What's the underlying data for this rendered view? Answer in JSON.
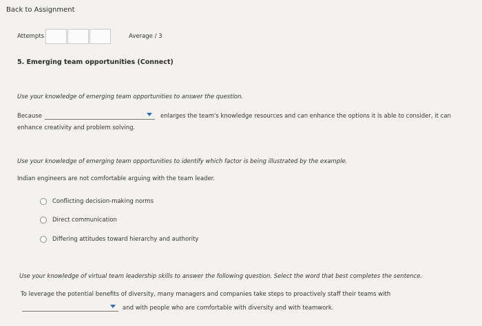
{
  "nav": {
    "back_link": "Back to Assignment"
  },
  "attempts": {
    "label": "Attempts",
    "average_label": "Average / 3"
  },
  "question": {
    "title": "5. Emerging team opportunities (Connect)",
    "part1": {
      "instruction": "Use your knowledge of emerging team opportunities to answer the question.",
      "prefix": "Because",
      "dropdown_value": "",
      "suffix": "enlarges the team's knowledge resources and can enhance the options it is able to consider, it can",
      "line2": "enhance creativity and problem solving."
    },
    "part2": {
      "instruction": "Use your knowledge of emerging team opportunities to identify which factor is being illustrated by the example.",
      "example": "Indian engineers are not comfortable arguing with the team leader.",
      "options": [
        "Conflicting decision-making norms",
        "Direct communication",
        "Differing attitudes toward hierarchy and authority"
      ]
    },
    "part3": {
      "instruction": "Use your knowledge of virtual team leadership skills to answer the following question. Select the word that best completes the sentence.",
      "line1": "To leverage the potential benefits of diversity, many managers and companies take steps to proactively staff their teams with",
      "dropdown_value": "",
      "line2": "and with people who are comfortable with diversity and with teamwork."
    }
  }
}
